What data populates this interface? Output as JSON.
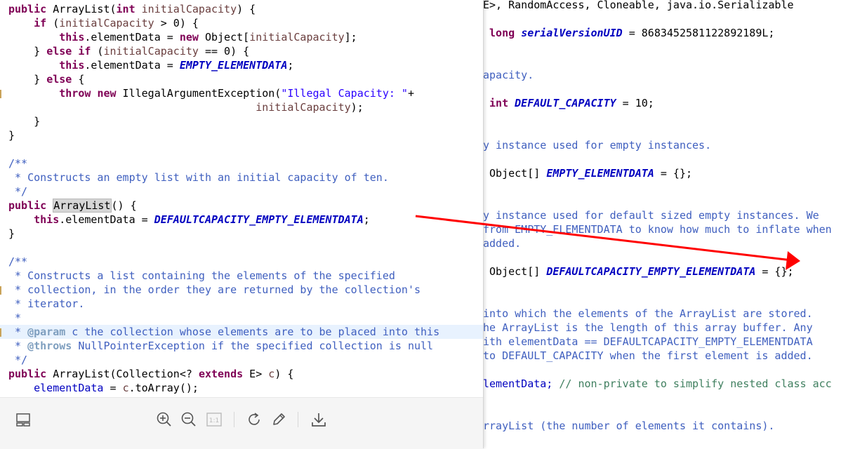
{
  "background_code": {
    "l1": "E>, RandomAccess, Cloneable, java.io.Serializable",
    "l2_kw": "long",
    "l2_field": "serialVersionUID",
    "l2_rest": " = 8683452581122892189L;",
    "l3": "apacity.",
    "l4_kw": "int",
    "l4_field": "DEFAULT_CAPACITY",
    "l4_rest": " = 10;",
    "l5": "y instance used for empty instances.",
    "l6_pre": "Object[] ",
    "l6_field": "EMPTY_ELEMENTDATA",
    "l6_rest": " = {};",
    "l7": "y instance used for default sized empty instances. We",
    "l8": "from EMPTY_ELEMENTDATA to know how much to inflate when",
    "l9": "added.",
    "l10_pre": "Object[] ",
    "l10_field": "DEFAULTCAPACITY_EMPTY_ELEMENTDATA",
    "l10_rest": " = {};",
    "l11": "into which the elements of the ArrayList are stored.",
    "l12": "he ArrayList is the length of this array buffer. Any",
    "l13": "ith elementData == DEFAULTCAPACITY_EMPTY_ELEMENTDATA",
    "l14": "to DEFAULT_CAPACITY when the first element is added.",
    "l15_pre": "lementData; ",
    "l15_cmt": "// non-private to simplify nested class acc",
    "l16": "rrayList (the number of elements it contains)."
  },
  "popup_code": {
    "a1_kw": "public",
    "a1_name": " ArrayList(",
    "a1_kw2": "int",
    "a1_par": " initialCapacity",
    "a1_end": ") {",
    "a2_kw": "if",
    "a2_open": " (",
    "a2_par": "initialCapacity",
    "a2_end": " > 0) {",
    "a3_kw": "this",
    "a3_mid": ".elementData = ",
    "a3_kw2": "new",
    "a3_obj": " Object[",
    "a3_par": "initialCapacity",
    "a3_end": "];",
    "a4_pre": "} ",
    "a4_kw": "else if",
    "a4_open": " (",
    "a4_par": "initialCapacity",
    "a4_end": " == 0) {",
    "a5_kw": "this",
    "a5_mid": ".elementData = ",
    "a5_field": "EMPTY_ELEMENTDATA",
    "a5_end": ";",
    "a6_pre": "} ",
    "a6_kw": "else",
    "a6_end": " {",
    "a7_kw": "throw",
    "a7_kw2": "new",
    "a7_mid": " IllegalArgumentException(",
    "a7_str": "\"Illegal Capacity: \"",
    "a7_end": "+",
    "a8_par": "initialCapacity",
    "a8_end": ");",
    "a9": "}",
    "a10": "}",
    "b1": "/**",
    "b2": " * Constructs an empty list with an initial capacity of ten.",
    "b3": " */",
    "b4_kw": "public",
    "b4_sel": "ArrayList",
    "b4_end": "() {",
    "b5_kw": "this",
    "b5_mid": ".elementData = ",
    "b5_field": "DEFAULTCAPACITY_EMPTY_ELEMENTDATA",
    "b5_end": ";",
    "b6": "}",
    "c1": "/**",
    "c2": " * Constructs a list containing the elements of the specified",
    "c3": " * collection, in the order they are returned by the collection's",
    "c4": " * iterator.",
    "c5": " *",
    "c6_pre": " * ",
    "c6_tag": "@param",
    "c6_rest": " c the collection whose elements are to be placed into this",
    "c7_pre": " * ",
    "c7_tag": "@throws",
    "c7_rest": " NullPointerException if the specified collection is null",
    "c8": " */",
    "d1_kw": "public",
    "d1_mid": " ArrayList(Collection<? ",
    "d1_kw2": "extends",
    "d1_mid2": " E> ",
    "d1_par": "c",
    "d1_end": ") {",
    "d2_fld": "elementData",
    "d2_mid": " = ",
    "d2_par": "c",
    "d2_end": ".toArray();"
  },
  "toolbar": {
    "icons": [
      "layout-icon",
      "zoom-in-icon",
      "zoom-out-icon",
      "actual-size-icon",
      "rotate-icon",
      "edit-icon",
      "download-icon"
    ],
    "actual_size_label": "1:1"
  },
  "colors": {
    "keyword": "#7f0055",
    "comment": "#3f5fbf",
    "field": "#0000c0",
    "string": "#2a00ff",
    "arrow": "#ff0000"
  }
}
